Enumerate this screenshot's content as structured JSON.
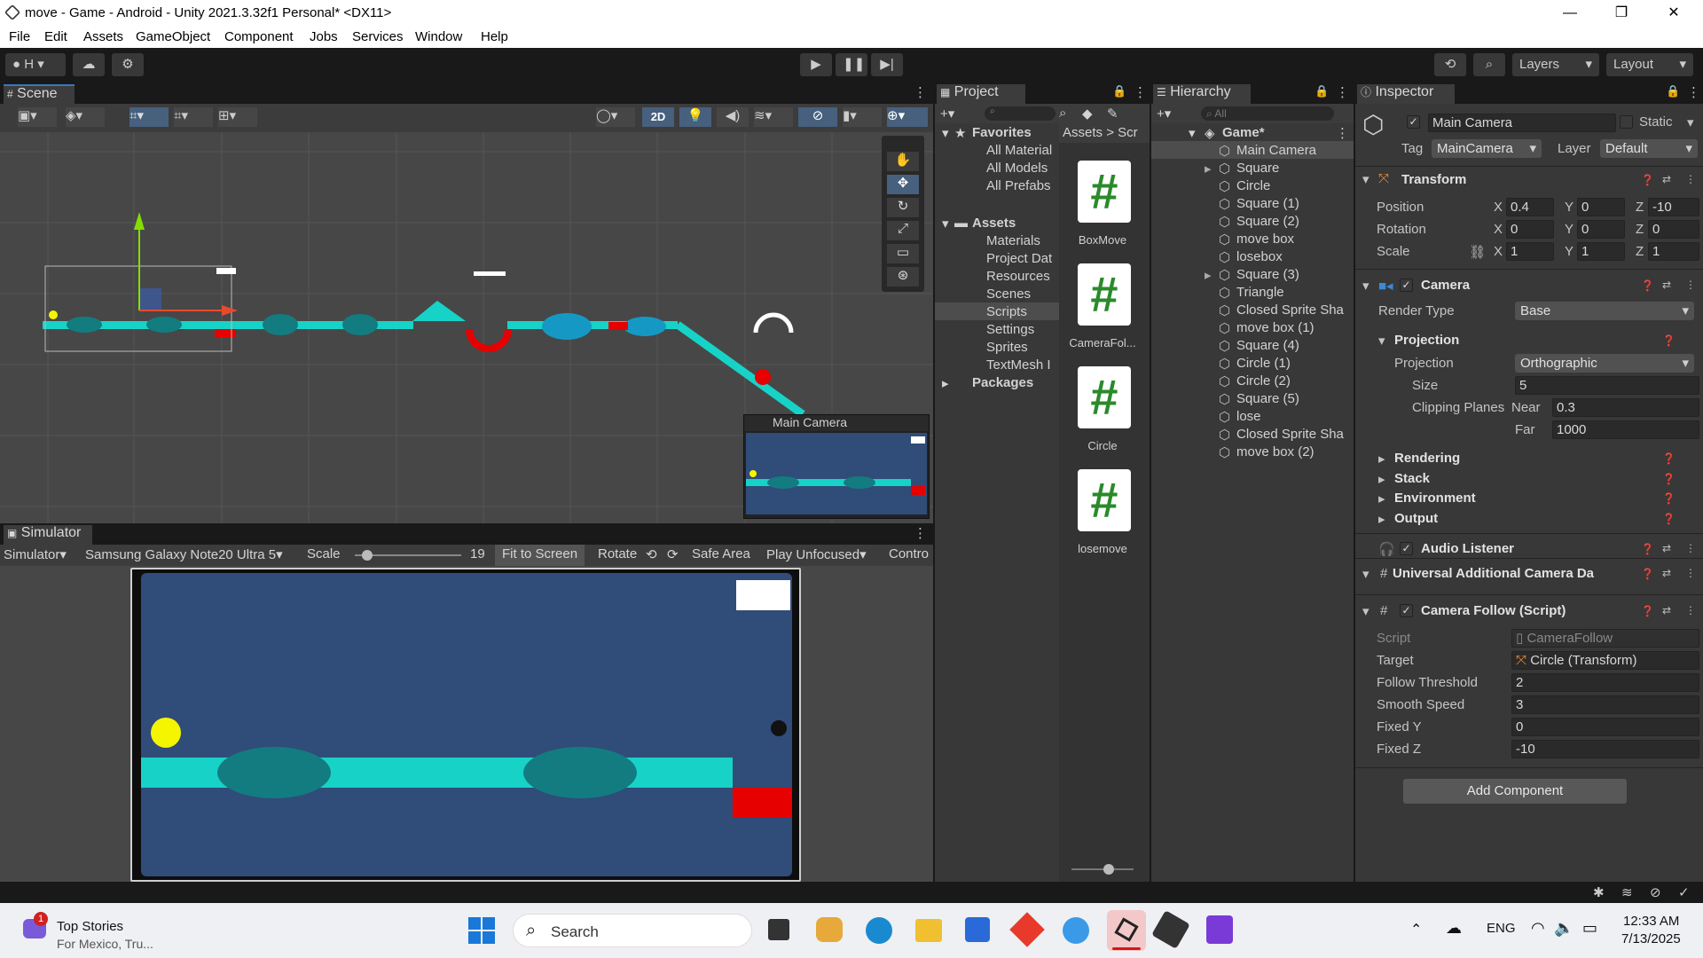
{
  "window": {
    "title": "move - Game - Android - Unity 2021.3.32f1 Personal* <DX11>",
    "minimize": "—",
    "maximize": "❐",
    "close": "✕"
  },
  "menu": [
    "File",
    "Edit",
    "Assets",
    "GameObject",
    "Component",
    "Jobs",
    "Services",
    "Window",
    "Help"
  ],
  "toolbar": {
    "account": "H",
    "layers": "Layers",
    "layout": "Layout"
  },
  "scene": {
    "tab": "Scene",
    "mode_2d": "2D",
    "camera_preview_title": "Main Camera"
  },
  "simulator": {
    "tab": "Simulator",
    "mode": "Simulator",
    "device": "Samsung Galaxy Note20 Ultra 5",
    "scale_label": "Scale",
    "scale_value": "19",
    "fit": "Fit to Screen",
    "rotate": "Rotate",
    "safe_area": "Safe Area",
    "play_mode": "Play Unfocused",
    "control": "Contro"
  },
  "project": {
    "tab": "Project",
    "favorites_header": "Favorites",
    "favorites": [
      "All Material",
      "All Models",
      "All Prefabs"
    ],
    "assets_header": "Assets",
    "assets": [
      "Materials",
      "Project Dat",
      "Resources",
      "Scenes",
      "Scripts",
      "Settings",
      "Sprites",
      "TextMesh I"
    ],
    "packages": "Packages",
    "breadcrumb_root": "Assets",
    "breadcrumb_current": "Scr",
    "scripts": [
      "BoxMove",
      "CameraFol...",
      "Circle",
      "losemove"
    ],
    "script_glyph": "#"
  },
  "hierarchy": {
    "tab": "Hierarchy",
    "search_placeholder": "All",
    "scene_name": "Game*",
    "items": [
      "Main Camera",
      "Square",
      "Circle",
      "Square (1)",
      "Square (2)",
      "move box",
      "losebox",
      "Square (3)",
      "Triangle",
      "Closed Sprite Sha",
      "move box (1)",
      "Square (4)",
      "Circle (1)",
      "Circle (2)",
      "Square (5)",
      "lose",
      "Closed Sprite Sha",
      "move box (2)"
    ]
  },
  "inspector": {
    "tab": "Inspector",
    "object_name": "Main Camera",
    "static_label": "Static",
    "tag_label": "Tag",
    "tag_value": "MainCamera",
    "layer_label": "Layer",
    "layer_value": "Default",
    "transform": {
      "title": "Transform",
      "position_label": "Position",
      "rotation_label": "Rotation",
      "scale_label": "Scale",
      "position": [
        "0.4",
        "0",
        "-10"
      ],
      "rotation": [
        "0",
        "0",
        "0"
      ],
      "scale": [
        "1",
        "1",
        "1"
      ],
      "axes": [
        "X",
        "Y",
        "Z"
      ]
    },
    "camera": {
      "title": "Camera",
      "render_type_label": "Render Type",
      "render_type": "Base",
      "projection_header": "Projection",
      "projection_label": "Projection",
      "projection_value": "Orthographic",
      "size_label": "Size",
      "size_value": "5",
      "clipping_label": "Clipping Planes",
      "near_label": "Near",
      "near_value": "0.3",
      "far_label": "Far",
      "far_value": "1000",
      "rendering": "Rendering",
      "stack": "Stack",
      "environment": "Environment",
      "output": "Output"
    },
    "audio_listener": "Audio Listener",
    "urp_camera": "Universal Additional Camera Da",
    "camera_follow": {
      "title": "Camera Follow (Script)",
      "script_label": "Script",
      "script_value": "CameraFollow",
      "target_label": "Target",
      "target_value": "Circle (Transform)",
      "threshold_label": "Follow Threshold",
      "threshold_value": "2",
      "smooth_label": "Smooth Speed",
      "smooth_value": "3",
      "fixed_y_label": "Fixed Y",
      "fixed_y_value": "0",
      "fixed_z_label": "Fixed Z",
      "fixed_z_value": "-10"
    },
    "add_component": "Add Component"
  },
  "taskbar": {
    "news_title": "Top Stories",
    "news_sub": "For Mexico, Tru...",
    "news_badge": "1",
    "search": "Search",
    "lang": "ENG",
    "time": "12:33 AM",
    "date": "7/13/2025"
  },
  "colors": {
    "game_bg": "#304c78",
    "platform": "#17d3c7",
    "platform_dark": "#137c80",
    "player": "#f5f500",
    "danger": "#e60000"
  }
}
